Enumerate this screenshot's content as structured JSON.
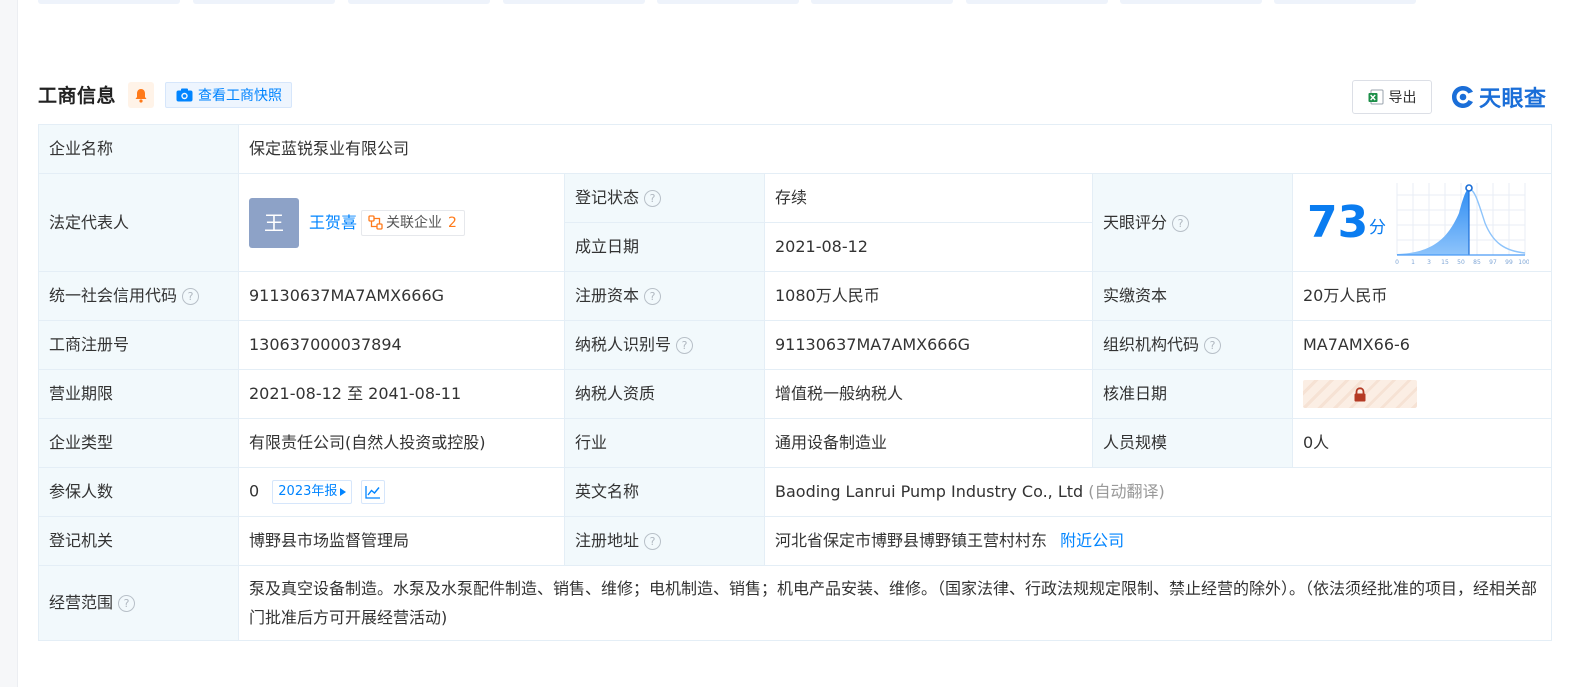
{
  "header": {
    "title": "工商信息",
    "snapshot_label": "查看工商快照",
    "export_label": "导出",
    "brand": "天眼查"
  },
  "rows": {
    "company_name": {
      "label": "企业名称",
      "value": "保定蓝锐泵业有限公司"
    },
    "legal_rep": {
      "label": "法定代表人",
      "avatar": "王",
      "name": "王贺喜",
      "related_label": "关联企业",
      "related_count": "2"
    },
    "reg_status": {
      "label": "登记状态",
      "value": "存续"
    },
    "founded": {
      "label": "成立日期",
      "value": "2021-08-12"
    },
    "tianyan_score": {
      "label": "天眼评分",
      "value": "73",
      "unit": "分",
      "chart_ticks": [
        "0",
        "1",
        "3",
        "15",
        "50",
        "85",
        "97",
        "99",
        "100"
      ]
    },
    "credit_code": {
      "label": "统一社会信用代码",
      "value": "91130637MA7AMX666G"
    },
    "reg_capital": {
      "label": "注册资本",
      "value": "1080万人民币"
    },
    "paid_capital": {
      "label": "实缴资本",
      "value": "20万人民币"
    },
    "reg_number": {
      "label": "工商注册号",
      "value": "130637000037894"
    },
    "taxpayer_id": {
      "label": "纳税人识别号",
      "value": "91130637MA7AMX666G"
    },
    "org_code": {
      "label": "组织机构代码",
      "value": "MA7AMX66-6"
    },
    "business_term": {
      "label": "营业期限",
      "value": "2021-08-12 至 2041-08-11"
    },
    "taxpayer_qual": {
      "label": "纳税人资质",
      "value": "增值税一般纳税人"
    },
    "approval_date": {
      "label": "核准日期"
    },
    "company_type": {
      "label": "企业类型",
      "value": "有限责任公司(自然人投资或控股)"
    },
    "industry": {
      "label": "行业",
      "value": "通用设备制造业"
    },
    "staff_size": {
      "label": "人员规模",
      "value": "0人"
    },
    "insured": {
      "label": "参保人数",
      "value": "0",
      "report_label": "2023年报"
    },
    "english_name": {
      "label": "英文名称",
      "value": "Baoding Lanrui Pump Industry Co., Ltd",
      "note": "(自动翻译)"
    },
    "reg_authority": {
      "label": "登记机关",
      "value": "博野县市场监督管理局"
    },
    "reg_address": {
      "label": "注册地址",
      "value": "河北省保定市博野县博野镇王营村村东",
      "link": "附近公司"
    },
    "business_scope": {
      "label": "经营范围",
      "value": "泵及真空设备制造。水泵及水泵配件制造、销售、维修；电机制造、销售；机电产品安装、维修。（国家法律、行政法规规定限制、禁止经营的除外）。（依法须经批准的项目，经相关部门批准后方可开展经营活动)"
    }
  },
  "colors": {
    "accent": "#0084ff",
    "label_bg": "#f2f9fc",
    "status_green": "#1e9f4d",
    "score_blue": "#0a7cf0",
    "count_orange": "#ff7a1a"
  },
  "icons": [
    "bell-icon",
    "camera-icon",
    "excel-icon",
    "brand-eye-icon",
    "related-network-icon",
    "trend-chart-icon",
    "lock-icon",
    "help-icon"
  ]
}
